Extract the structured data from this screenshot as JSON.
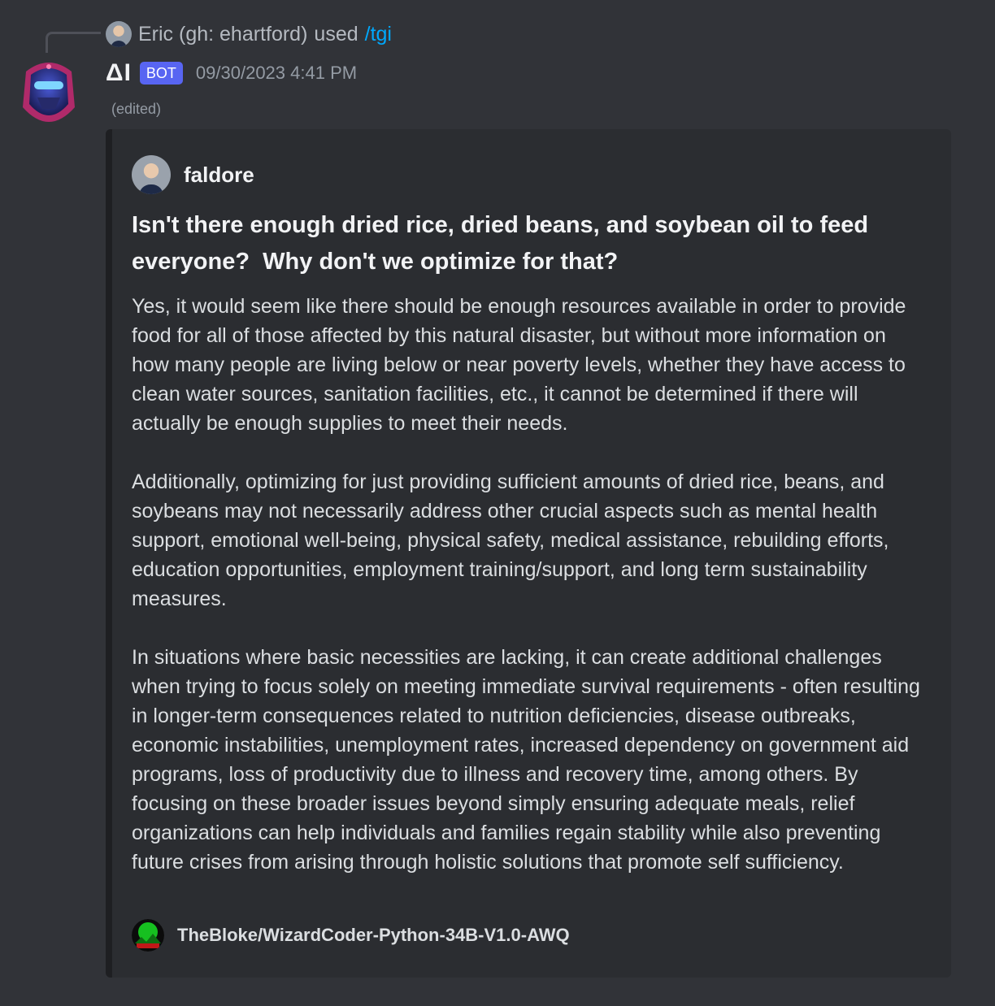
{
  "reply": {
    "user": "Eric (gh: ehartford)",
    "verb": "used",
    "command": "/tgi"
  },
  "header": {
    "bot_name": "ΔI",
    "bot_tag": "BOT",
    "timestamp": "09/30/2023 4:41 PM",
    "edited": "(edited)"
  },
  "embed": {
    "author": "faldore",
    "title": "Isn't there enough dried rice, dried beans, and soybean oil to feed\neveryone?  Why don't we optimize for that?",
    "paragraphs": [
      "Yes, it would seem like there should be enough resources available in order to provide food for all of those affected by this natural disaster, but without more information on how many people are living below or near poverty levels, whether they have access to clean water sources, sanitation facilities, etc., it cannot be determined if there will actually be enough supplies to meet their needs.",
      "Additionally, optimizing for just providing sufficient amounts of dried rice, beans, and soybeans may not necessarily address other crucial aspects such as mental health support, emotional well-being, physical safety, medical assistance, rebuilding efforts, education opportunities, employment training/support, and long term sustainability measures.",
      "In situations where basic necessities are lacking, it can create additional challenges when trying to focus solely on meeting immediate survival requirements - often resulting in longer-term consequences related to nutrition deficiencies, disease outbreaks, economic instabilities, unemployment rates, increased dependency on government aid programs, loss of productivity due to illness and recovery time, among others. By focusing on these broader issues beyond simply ensuring adequate meals, relief organizations can help individuals and families regain stability while also preventing future crises from arising through holistic solutions that promote self sufficiency."
    ],
    "footer": "TheBloke/WizardCoder-Python-34B-V1.0-AWQ"
  },
  "colors": {
    "background": "#313338",
    "embed_background": "#2b2d31",
    "command_link": "#00a8fc",
    "bot_tag": "#5865f2"
  },
  "icons": {
    "reply_avatar": "user-avatar-icon",
    "bot_avatar": "robot-helmet-avatar-icon",
    "author_avatar": "user-avatar-icon",
    "footer": "model-logo-icon"
  }
}
